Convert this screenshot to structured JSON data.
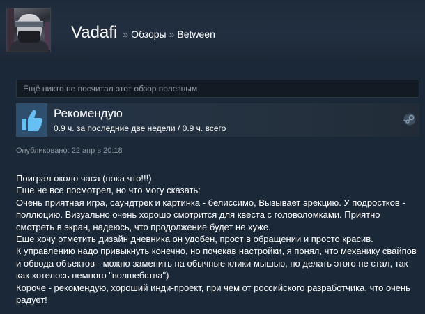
{
  "profile": {
    "name": "Vadafi",
    "separator": "»",
    "breadcrumbs": [
      "Обзоры",
      "Between"
    ]
  },
  "helpful_text": "Ещё никто не посчитал этот обзор полезным",
  "review": {
    "verdict": "Рекомендую",
    "hours": "0.9 ч. за последние две недели / 0.9 ч. всего",
    "posted": "Опубликовано: 22 апр в 20:18",
    "lines": [
      "Поиграл около часа (пока что!!!)",
      "Еще не все посмотрел, но что могу сказать:",
      "Очень приятная игра, саундтрек и картинка - белиссимо, Вызывает эрекцию. У подростков -",
      "поллюцию. Визуально очень хорошо смотрится для квеста с головоломками. Приятно",
      "смотреть в экран, надеюсь, что продолжение будет не хуже.",
      "Еще хочу отметить дизайн дневника он удобен, прост в обращении и просто красив.",
      "К управлению надо привыкнуть конечно, но почекав настройки, я понял, что механику свайпов",
      "и обвода объектов - можно заменить на обычные клики мышью, но делать этого не стал, так",
      "как хотелось немного \"волшебства\")",
      "Короче - рекомендую, хороший инди-проект, при чем от российского разработчика, что очень",
      "радует!"
    ]
  },
  "icons": {
    "thumb": "thumbs-up-icon",
    "platform": "steam-icon"
  },
  "colors": {
    "background": "#1b2838",
    "thumb_fill": "#66c0f4",
    "muted_text": "#8f98a0"
  }
}
